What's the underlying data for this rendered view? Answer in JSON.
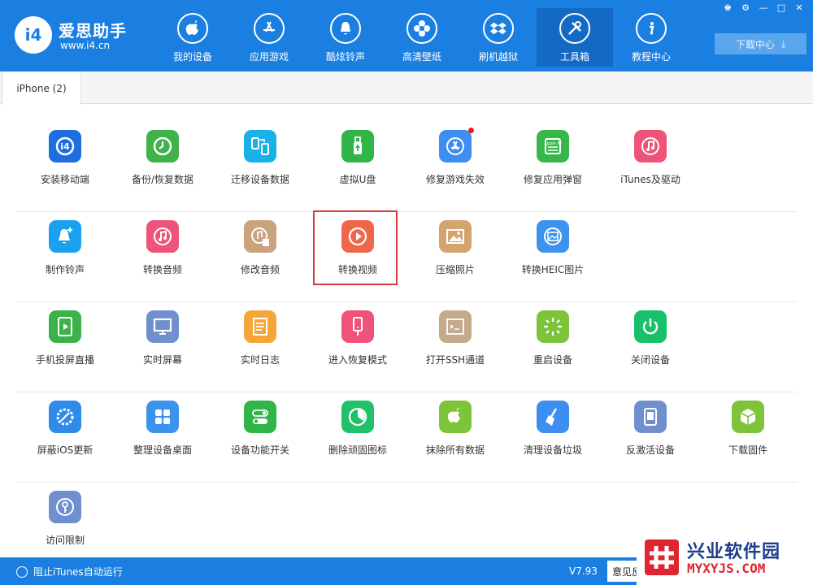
{
  "app": {
    "brand": "爱思助手",
    "url": "www.i4.cn",
    "logo_text": "i4"
  },
  "nav": [
    {
      "label": "我的设备",
      "icon": "apple-icon"
    },
    {
      "label": "应用游戏",
      "icon": "app-store-icon"
    },
    {
      "label": "酷炫铃声",
      "icon": "bell-icon"
    },
    {
      "label": "高清壁纸",
      "icon": "flower-icon"
    },
    {
      "label": "刷机越狱",
      "icon": "dropbox-icon"
    },
    {
      "label": "工具箱",
      "icon": "tools-icon",
      "active": true
    },
    {
      "label": "教程中心",
      "icon": "info-icon"
    }
  ],
  "window_controls": [
    "shirt-icon",
    "gear-icon",
    "minimize-icon",
    "maximize-icon",
    "close-icon"
  ],
  "download_center": "下载中心",
  "device_tab": "iPhone (2)",
  "tools": [
    [
      {
        "label": "安装移动端",
        "icon": "i4-app-icon",
        "color": "#1d6fe0"
      },
      {
        "label": "备份/恢复数据",
        "icon": "backup-clock-icon",
        "color": "#3fb24a"
      },
      {
        "label": "迁移设备数据",
        "icon": "migrate-phones-icon",
        "color": "#18b1e8"
      },
      {
        "label": "虚拟U盘",
        "icon": "usb-drive-icon",
        "color": "#2fb548"
      },
      {
        "label": "修复游戏失效",
        "icon": "app-store-repair-icon",
        "color": "#3d8ef0",
        "badge": true
      },
      {
        "label": "修复应用弹窗",
        "icon": "apple-id-icon",
        "color": "#37b64a"
      },
      {
        "label": "iTunes及驱动",
        "icon": "itunes-icon",
        "color": "#f0537a"
      }
    ],
    [
      {
        "label": "制作铃声",
        "icon": "bell-plus-icon",
        "color": "#1aa2f0"
      },
      {
        "label": "转换音频",
        "icon": "music-convert-icon",
        "color": "#f0537a"
      },
      {
        "label": "修改音频",
        "icon": "music-edit-icon",
        "color": "#c9a27e"
      },
      {
        "label": "转换视频",
        "icon": "video-play-icon",
        "color": "#f0664a",
        "highlighted": true
      },
      {
        "label": "压缩照片",
        "icon": "photo-icon",
        "color": "#d4a46e"
      },
      {
        "label": "转换HEIC图片",
        "icon": "heic-photo-icon",
        "color": "#3b93ee"
      }
    ],
    [
      {
        "label": "手机投屏直播",
        "icon": "screen-cast-icon",
        "color": "#3bb24a"
      },
      {
        "label": "实时屏幕",
        "icon": "monitor-icon",
        "color": "#6f8fcf"
      },
      {
        "label": "实时日志",
        "icon": "document-icon",
        "color": "#f5a638"
      },
      {
        "label": "进入恢复模式",
        "icon": "phone-cable-icon",
        "color": "#f0537a"
      },
      {
        "label": "打开SSH通道",
        "icon": "terminal-icon",
        "color": "#c4a98a"
      },
      {
        "label": "重启设备",
        "icon": "restart-spinner-icon",
        "color": "#7ec43b"
      },
      {
        "label": "关闭设备",
        "icon": "power-icon",
        "color": "#19c06a"
      }
    ],
    [
      {
        "label": "屏蔽iOS更新",
        "icon": "block-update-gear-icon",
        "color": "#2f8ae8"
      },
      {
        "label": "整理设备桌面",
        "icon": "grid-icon",
        "color": "#3b93ee"
      },
      {
        "label": "设备功能开关",
        "icon": "toggle-icon",
        "color": "#2fb548"
      },
      {
        "label": "删除顽固图标",
        "icon": "pie-icon",
        "color": "#21c169"
      },
      {
        "label": "抹除所有数据",
        "icon": "apple-erase-icon",
        "color": "#7ec43b"
      },
      {
        "label": "清理设备垃圾",
        "icon": "broom-icon",
        "color": "#3d8ef0"
      },
      {
        "label": "反激活设备",
        "icon": "tablet-icon",
        "color": "#6f8fcf"
      },
      {
        "label": "下载固件",
        "icon": "box-icon",
        "color": "#7ec43b"
      }
    ],
    [
      {
        "label": "访问限制",
        "icon": "key-icon",
        "color": "#6f8fcf"
      }
    ]
  ],
  "footer": {
    "itunes_option": "阻止iTunes自动运行",
    "version": "V7.93",
    "feedback": "意见反"
  },
  "watermark": {
    "title": "兴业软件园",
    "url": "MYXYJS.COM"
  }
}
